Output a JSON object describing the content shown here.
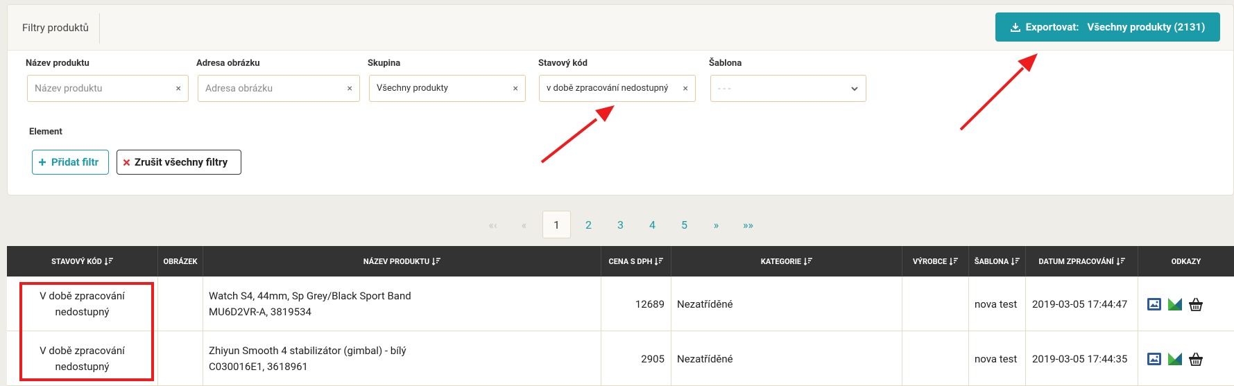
{
  "panel": {
    "title": "Filtry produktů",
    "export_label": "Exportovat:",
    "export_value": "Všechny produkty (2131)"
  },
  "filters": [
    {
      "label": "Název produktu",
      "placeholder": "Název produktu",
      "value": "",
      "clear": "×"
    },
    {
      "label": "Adresa obrázku",
      "placeholder": "Adresa obrázku",
      "value": "",
      "clear": "×"
    },
    {
      "label": "Skupina",
      "placeholder": "",
      "value": "Všechny produkty",
      "clear": "×"
    },
    {
      "label": "Stavový kód",
      "placeholder": "",
      "value": "v době zpracování nedostupný",
      "clear": "×"
    },
    {
      "label": "Šablona",
      "placeholder": "- - -",
      "value": ""
    }
  ],
  "element_label": "Element",
  "buttons": {
    "add_filter": "Přidat filtr",
    "clear_filters": "Zrušit všechny filtry"
  },
  "pagination": {
    "first": "«‹",
    "prev": "«",
    "pages": [
      "1",
      "2",
      "3",
      "4",
      "5"
    ],
    "active": "1",
    "next": "»",
    "last": "»»"
  },
  "table": {
    "headers": [
      "STAVOVÝ KÓD",
      "OBRÁZEK",
      "NÁZEV PRODUKTU",
      "CENA S DPH",
      "KATEGORIE",
      "VÝROBCE",
      "ŠABLONA",
      "DATUM ZPRACOVÁNÍ",
      "ODKAZY"
    ],
    "rows": [
      {
        "status": "V době zpracování nedostupný",
        "image": "",
        "name_line1": "Watch S4, 44mm, Sp Grey/Black Sport Band",
        "name_line2": "MU6D2VR-A, 3819534",
        "price": "12689",
        "category": "Nezatříděné",
        "manufacturer": "",
        "template": "nova test",
        "date": "2019-03-05 17:44:47"
      },
      {
        "status": "V době zpracování nedostupný",
        "image": "",
        "name_line1": "Zhiyun Smooth 4 stabilizátor (gimbal) - bílý",
        "name_line2": "C030016E1, 3618961",
        "price": "2905",
        "category": "Nezatříděné",
        "manufacturer": "",
        "template": "nova test",
        "date": "2019-03-05 17:44:35"
      }
    ]
  },
  "icons": {
    "download": "download-icon",
    "plus": "plus-icon",
    "times": "times-icon",
    "sort": "sort-icon",
    "image": "image-icon",
    "heureka": "heureka-icon",
    "basket": "basket-icon"
  },
  "colors": {
    "accent": "#1a9ba7",
    "annotation": "#ee1c1c",
    "header_bg": "#333333"
  }
}
